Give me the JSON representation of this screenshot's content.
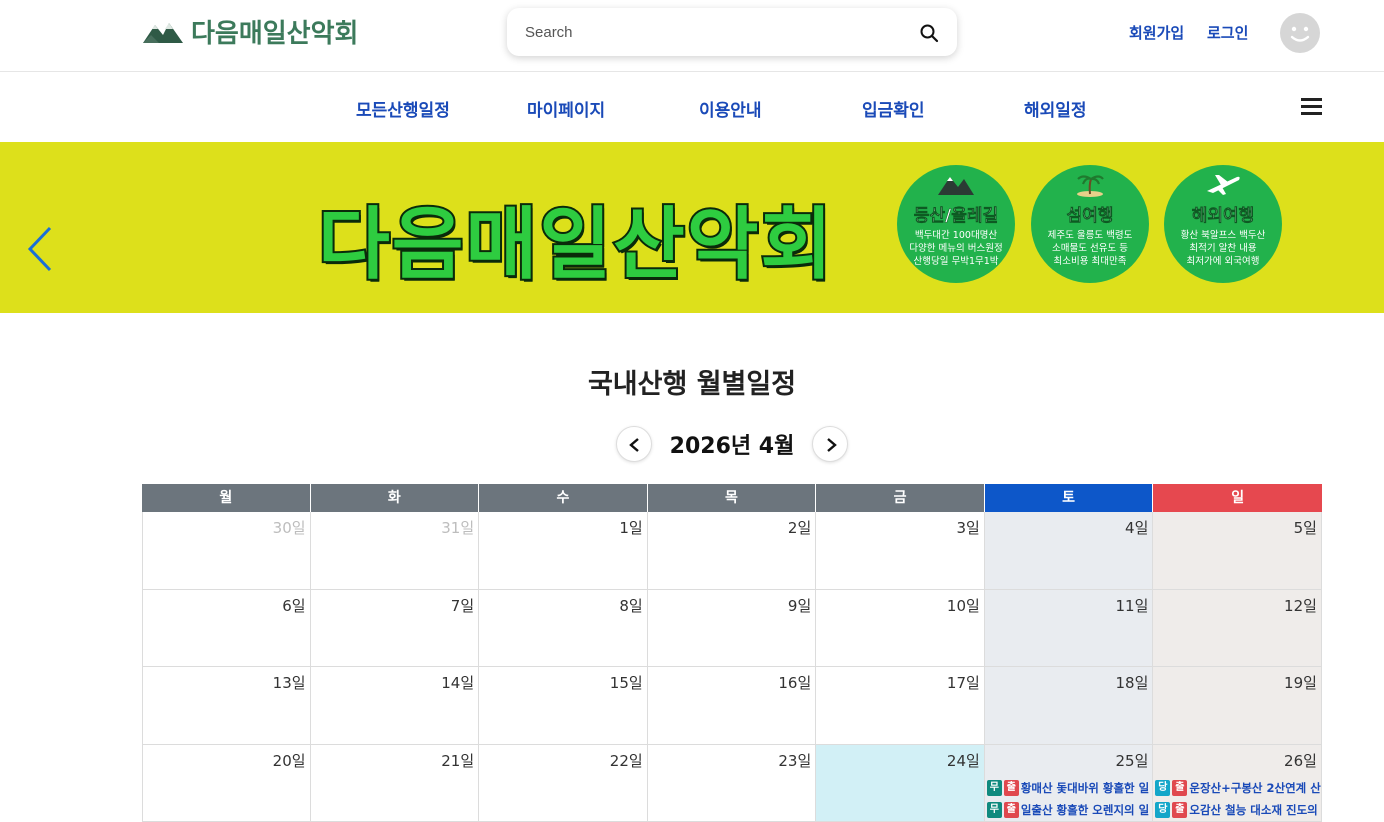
{
  "header": {
    "logo_text": "다음매일산악회",
    "search_placeholder": "Search",
    "signup": "회원가입",
    "login": "로그인"
  },
  "nav": {
    "items": [
      "모든산행일정",
      "마이페이지",
      "이용안내",
      "입금확인",
      "해외일정"
    ]
  },
  "banner": {
    "title": "다음매일산악회",
    "circles": [
      {
        "title": "등산/올레길",
        "lines": [
          "백두대간 100대명산",
          "다양한 메뉴의 버스원정",
          "산행당일 무박1무1박"
        ]
      },
      {
        "title": "섬여행",
        "lines": [
          "제주도 울릉도 백령도",
          "소매물도 선유도 등",
          "최소비용 최대만족"
        ]
      },
      {
        "title": "해외여행",
        "lines": [
          "황산 북알프스 백두산",
          "최적기 알찬 내용",
          "최저가에 외국여행"
        ]
      }
    ]
  },
  "schedule": {
    "title": "국내산행 월별일정",
    "month_label": "2026년 4월",
    "weekdays": [
      "월",
      "화",
      "수",
      "목",
      "금",
      "토",
      "일"
    ],
    "weeks": [
      [
        "30일",
        "31일",
        "1일",
        "2일",
        "3일",
        "4일",
        "5일"
      ],
      [
        "6일",
        "7일",
        "8일",
        "9일",
        "10일",
        "11일",
        "12일"
      ],
      [
        "13일",
        "14일",
        "15일",
        "16일",
        "17일",
        "18일",
        "19일"
      ],
      [
        "20일",
        "21일",
        "22일",
        "23일",
        "24일",
        "25일",
        "26일"
      ]
    ],
    "events": {
      "sat_25": [
        {
          "badge1": "무",
          "badge2": "출",
          "text": "황매산 돛대바위 황홀한 일"
        },
        {
          "badge1": "무",
          "badge2": "출",
          "text": "일출산 황홀한 오렌지의 일"
        }
      ],
      "sun_26": [
        {
          "badge1": "당",
          "badge2": "출",
          "text": "운장산+구봉산 2산연계 산"
        },
        {
          "badge1": "당",
          "badge2": "출",
          "text": "오감산 철능 대소재 진도의"
        }
      ]
    }
  },
  "colors": {
    "brand_green": "#3c7a5b",
    "nav_blue": "#1a4ab8",
    "banner_yellow": "#dde01b",
    "circle_green": "#22b24c",
    "weekday_header": "#6c757d",
    "saturday_header": "#0d57c9",
    "sunday_header": "#e6484f",
    "badge_teal": "#0f8a7e",
    "badge_red": "#e0484e",
    "badge_cyan": "#13a6c9"
  }
}
